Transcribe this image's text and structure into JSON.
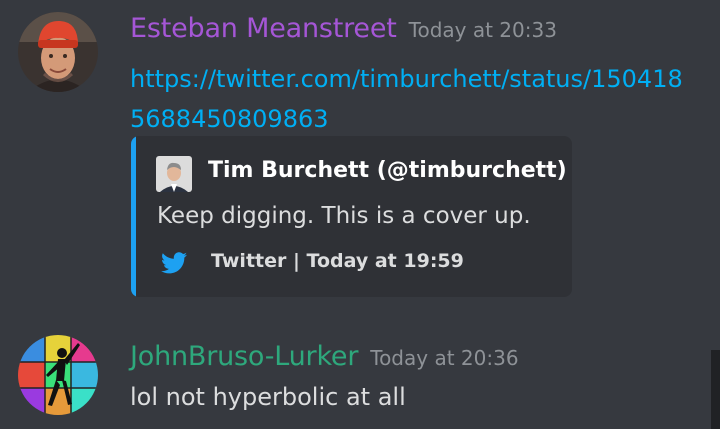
{
  "messages": [
    {
      "username": "Esteban Meanstreet",
      "username_color": "#a556d6",
      "timestamp": "Today at 20:33",
      "link_text": "https://twitter.com/timburchett/status/1504185688450809863",
      "embed": {
        "accent_color": "#1da1f2",
        "author": "Tim Burchett (@timburchett)",
        "description": "Keep digging. This is a cover up.",
        "footer": "Twitter | Today at 19:59",
        "footer_icon": "twitter-bird-icon"
      }
    },
    {
      "username": "JohnBruso-Lurker",
      "username_color": "#2ea87c",
      "timestamp": "Today at 20:36",
      "content": "lol not hyperbolic at all"
    }
  ],
  "colors": {
    "background": "#36393f",
    "embed_background": "#2f3136",
    "link": "#00aff4",
    "timestamp": "#8e9297"
  }
}
